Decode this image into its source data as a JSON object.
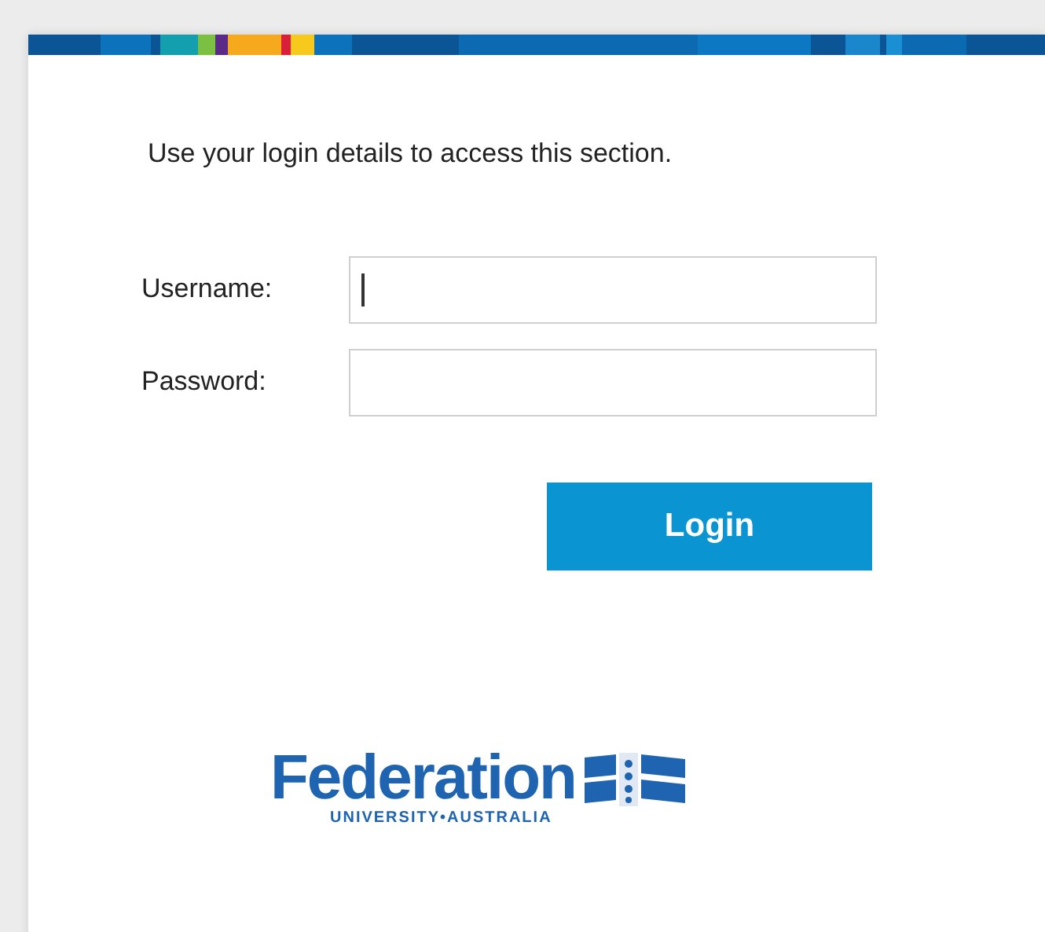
{
  "intro": "Use your login details to access this section.",
  "fields": [
    {
      "label": "Username:",
      "focused": true
    },
    {
      "label": "Password:",
      "focused": false
    }
  ],
  "button": "Login",
  "logo": {
    "name": "Federation",
    "tagline": "UNIVERSITY•AUSTRALIA"
  }
}
